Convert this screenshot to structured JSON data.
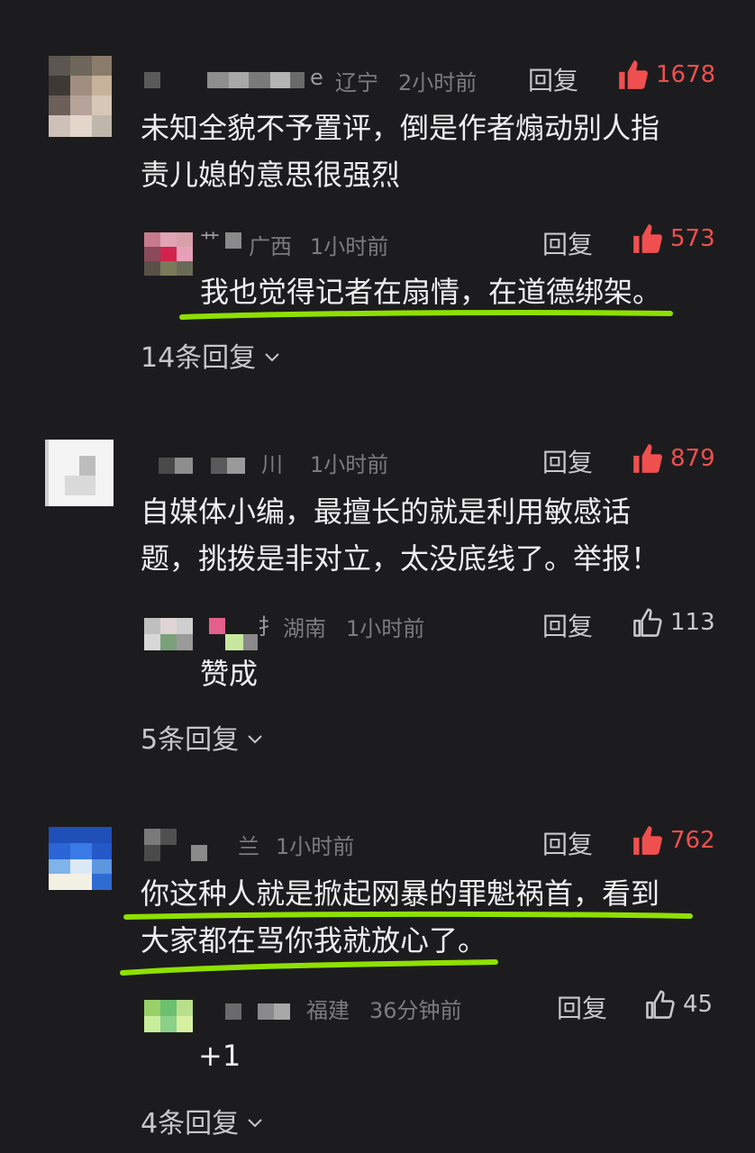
{
  "comments": [
    {
      "location": "辽宁",
      "time": "2小时前",
      "reply_label": "回复",
      "likes": "1678",
      "liked": true,
      "text_lines": [
        "未知全貌不予置评，倒是作者煽动别人指",
        "责儿媳的意思很强烈"
      ],
      "name_fragment": "e",
      "sub_reply": {
        "location": "广西",
        "time": "1小时前",
        "reply_label": "回复",
        "likes": "573",
        "liked": true,
        "text": "我也觉得记者在扇情，在道德绑架。",
        "name_fragment": "艹"
      },
      "more_replies": "14条回复"
    },
    {
      "location": "川",
      "time": "1小时前",
      "reply_label": "回复",
      "likes": "879",
      "liked": true,
      "text_lines": [
        "自媒体小编，最擅长的就是利用敏感话",
        "题，挑拨是非对立，太没底线了。举报！"
      ],
      "sub_reply": {
        "location": "湖南",
        "time": "1小时前",
        "reply_label": "回复",
        "likes": "113",
        "liked": false,
        "text": "赞成",
        "name_fragment": "扌"
      },
      "more_replies": "5条回复"
    },
    {
      "location": "兰",
      "time": "1小时前",
      "reply_label": "回复",
      "likes": "762",
      "liked": true,
      "text_lines": [
        "你这种人就是掀起网暴的罪魁祸首，看到",
        "大家都在骂你我就放心了。"
      ],
      "sub_reply": {
        "location": "福建",
        "time": "36分钟前",
        "reply_label": "回复",
        "likes": "45",
        "liked": false,
        "text": "+1"
      },
      "more_replies": "4条回复"
    }
  ],
  "colors": {
    "background": "#1c1c1e",
    "like_red": "#ef4f4f",
    "meta_grey": "#7c7c80",
    "highlight_green": "#8fe000"
  },
  "icons": {
    "like": "thumbs-up-icon",
    "expand": "chevron-down-icon"
  }
}
